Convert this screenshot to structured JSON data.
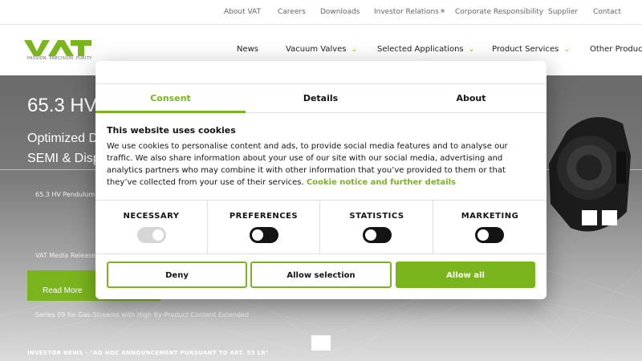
{
  "topbar": {
    "links": [
      "About VAT",
      "Careers",
      "Downloads",
      "Investor Relations",
      "Corporate Responsibility",
      "Supplier",
      "Contact"
    ]
  },
  "brand": {
    "logo_text": "VAT",
    "tagline": "PASSION. PRECISION. PURITY."
  },
  "nav": {
    "items": [
      "News",
      "Vacuum Valves",
      "Selected Applications",
      "Product Services",
      "Other Products"
    ]
  },
  "hero": {
    "title": "65.3 HV",
    "subtitle_line1": "Optimized D",
    "subtitle_line2": "SEMI & Disp",
    "news_1": "65.3 HV Pendulum",
    "news_2": "VAT Media Release",
    "read_more": "Read More",
    "news_3": "Series 09 for Gas-Streams with High By-Product Content Extended",
    "investor_news": "INVESTOR NEWS - \"AD HOC ANNOUNCEMENT PURSUANT TO ART. 53 LR\""
  },
  "consent": {
    "tabs": [
      "Consent",
      "Details",
      "About"
    ],
    "active_tab": "Consent",
    "title": "This website uses cookies",
    "body": "We use cookies to personalise content and ads, to provide social media features and to analyse our traffic. We also share information about your use of our site with our social media, advertising and analytics partners who may combine it with other information that you’ve provided to them or that they’ve collected from your use of their services. ",
    "link": "Cookie notice and further details",
    "categories": [
      {
        "label": "NECESSARY",
        "enabled": true,
        "locked": true
      },
      {
        "label": "PREFERENCES",
        "enabled": false,
        "locked": false
      },
      {
        "label": "STATISTICS",
        "enabled": false,
        "locked": false
      },
      {
        "label": "MARKETING",
        "enabled": false,
        "locked": false
      }
    ],
    "buttons": {
      "deny": "Deny",
      "allow_selection": "Allow selection",
      "allow_all": "Allow all"
    }
  },
  "colors": {
    "accent": "#7ab51d",
    "text": "#141414"
  }
}
